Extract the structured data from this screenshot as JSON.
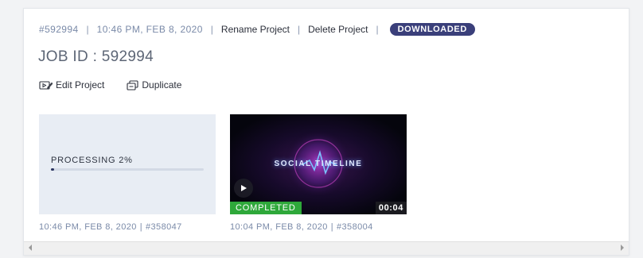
{
  "header": {
    "project_id": "#592994",
    "timestamp": "10:46 PM, FEB 8, 2020",
    "separator": "|",
    "rename_label": "Rename Project",
    "delete_label": "Delete Project",
    "status_badge": "DOWNLOADED"
  },
  "job_title": "JOB ID : 592994",
  "actions": {
    "edit_label": "Edit Project",
    "duplicate_label": "Duplicate"
  },
  "renders": [
    {
      "status_label": "PROCESSING 2%",
      "progress": 0.02,
      "timestamp": "10:46 PM, FEB 8, 2020",
      "pipe": "|",
      "render_id": "#358047"
    },
    {
      "status_label": "COMPLETED",
      "video_title": "SOCIAL TIMELINE",
      "duration": "00:04",
      "timestamp": "10:04 PM, FEB 8, 2020",
      "pipe": "|",
      "render_id": "#358004"
    }
  ],
  "icons": {
    "edit": "edit-video-icon",
    "duplicate": "duplicate-icon",
    "play": "play-icon"
  },
  "colors": {
    "badge": "#3a3f7a",
    "completed": "#2ea83a",
    "progress_fill": "#2b3560"
  }
}
